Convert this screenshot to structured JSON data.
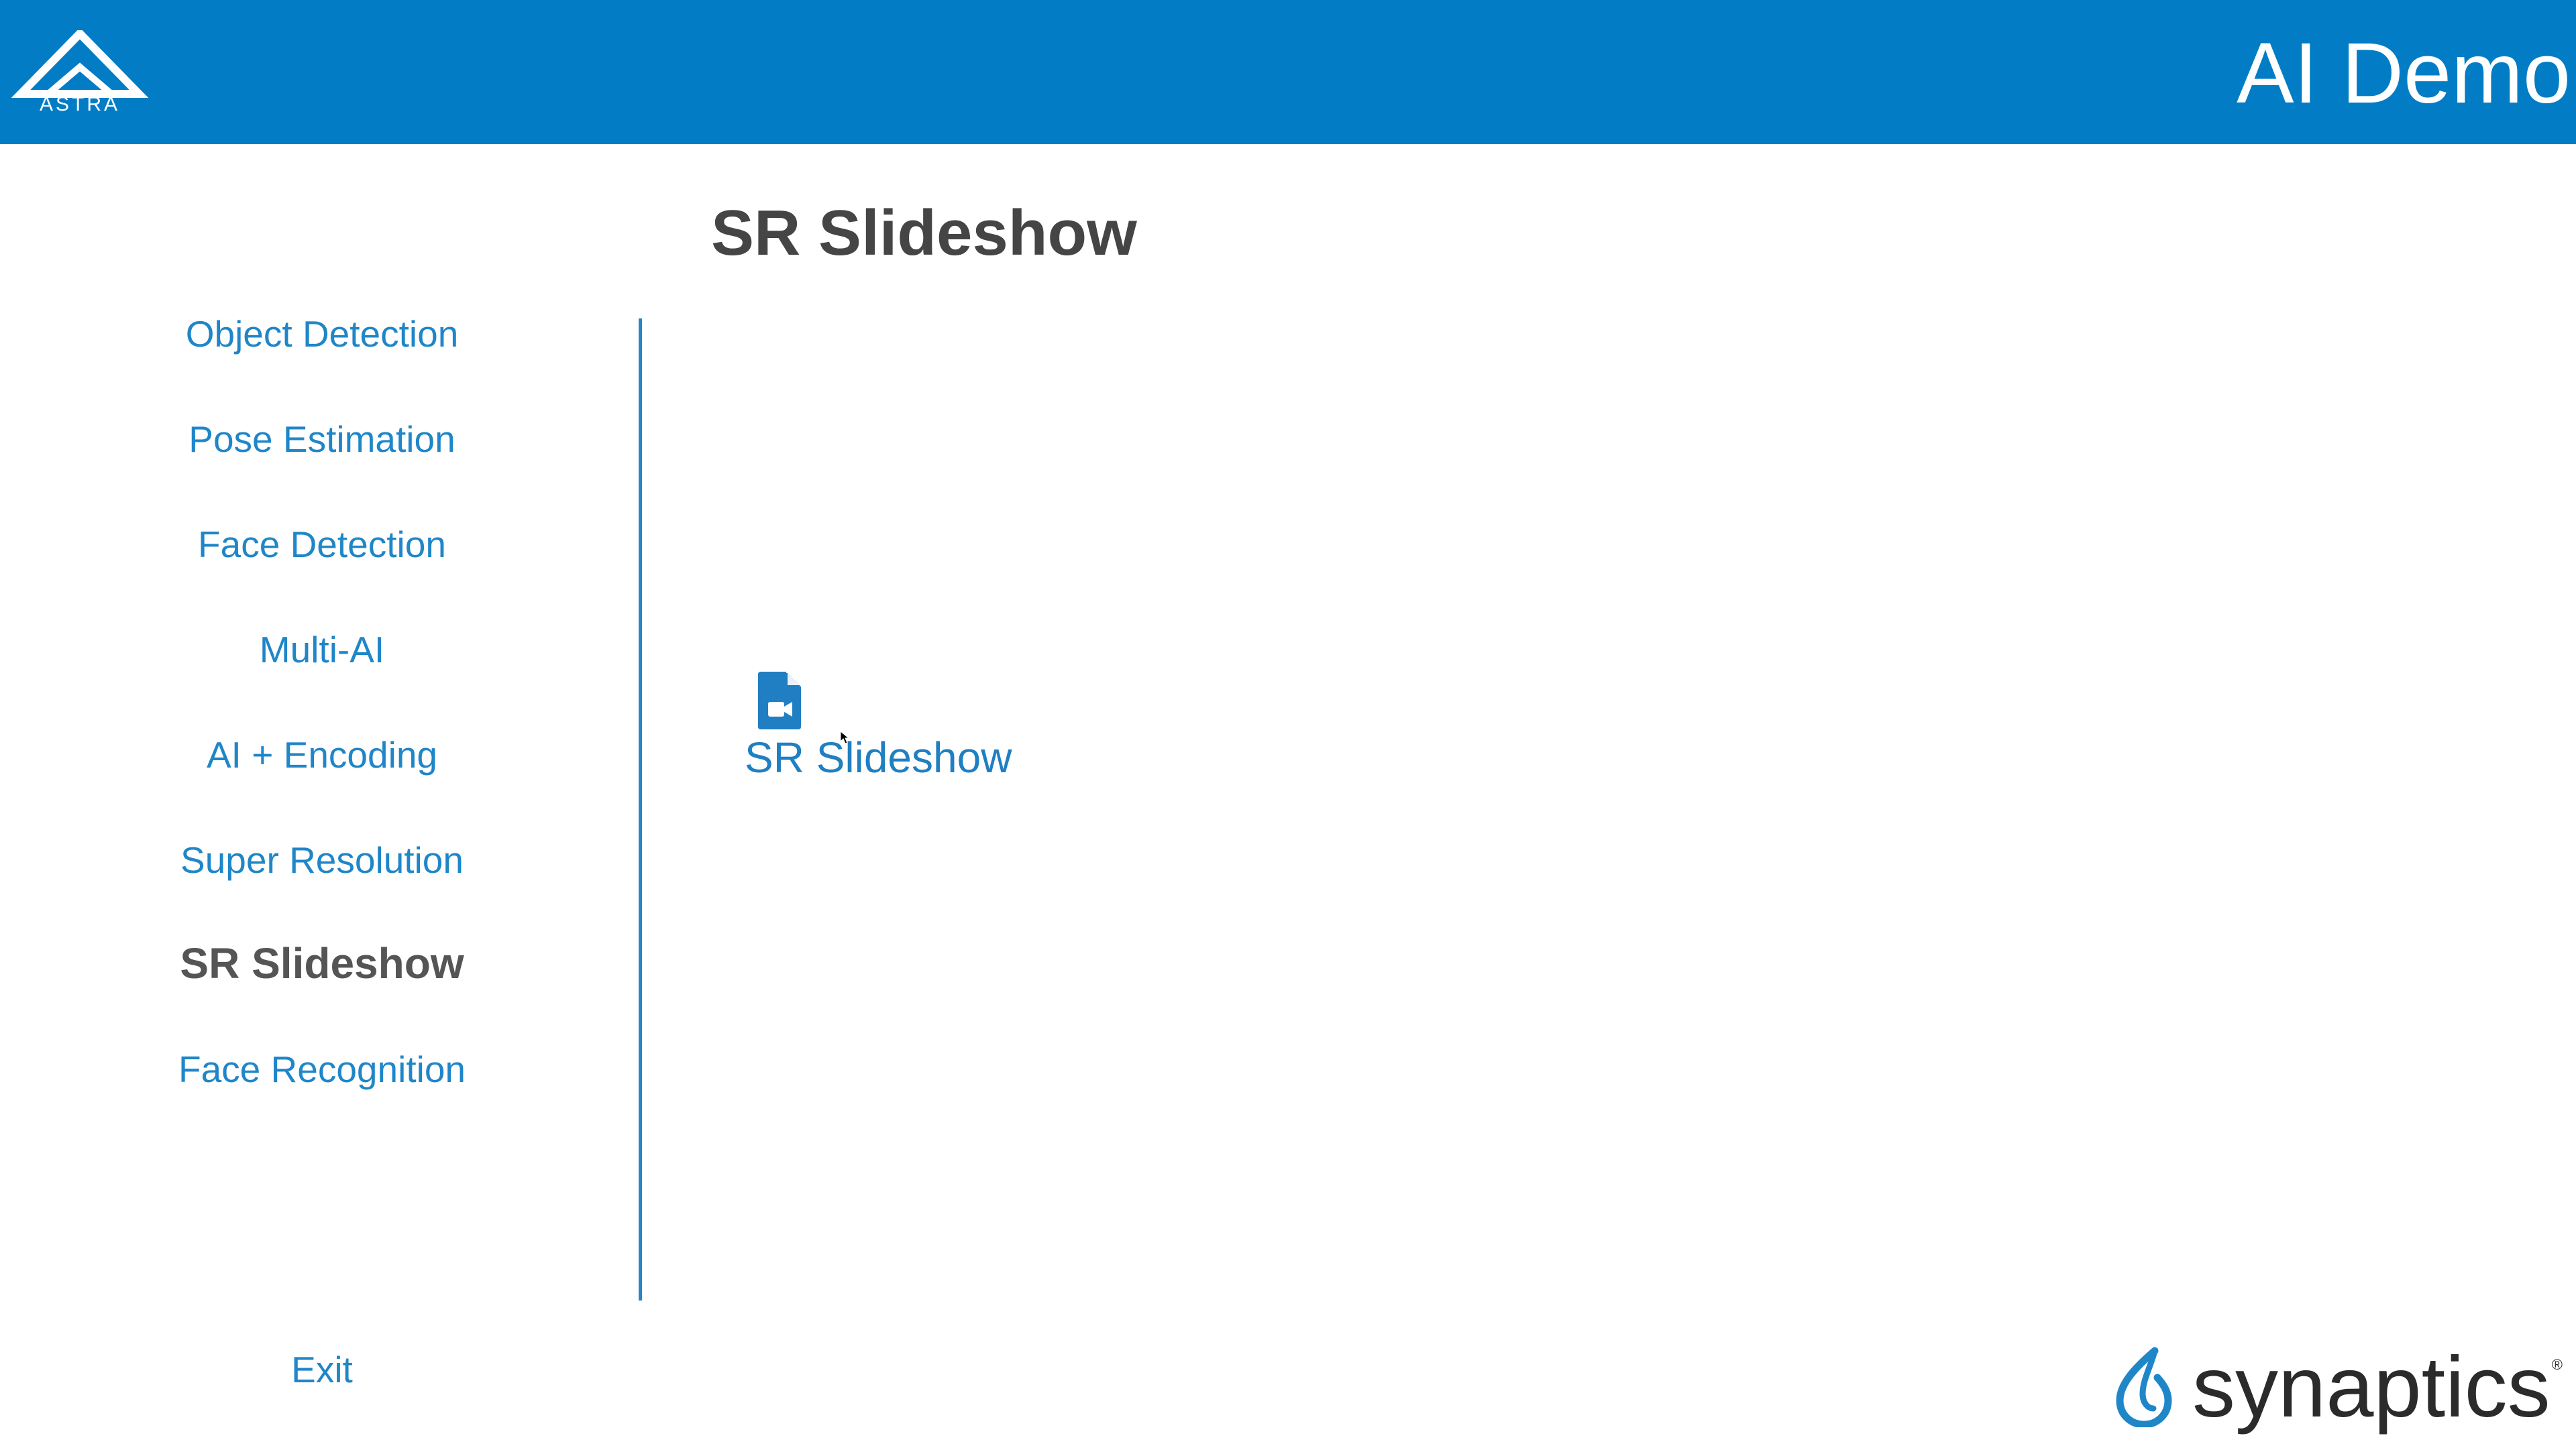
{
  "header": {
    "logo_text": "ASTRA",
    "title": "AI Demo",
    "background_color": "#027dc5"
  },
  "page": {
    "title": "SR Slideshow"
  },
  "sidebar": {
    "items": [
      {
        "label": "Object Detection"
      },
      {
        "label": "Pose Estimation"
      },
      {
        "label": "Face Detection"
      },
      {
        "label": "Multi-AI"
      },
      {
        "label": "AI + Encoding"
      },
      {
        "label": "Super Resolution"
      },
      {
        "label": "SR Slideshow",
        "active": true
      },
      {
        "label": "Face Recognition"
      }
    ],
    "exit_label": "Exit"
  },
  "content": {
    "items": [
      {
        "label": "SR Slideshow",
        "icon": "video-file-icon"
      }
    ]
  },
  "footer": {
    "brand_name": "synaptics",
    "brand_reg": "®"
  },
  "colors": {
    "accent": "#027dc5",
    "link": "#1f86c8",
    "active_text": "#555555",
    "heading": "#454545"
  }
}
